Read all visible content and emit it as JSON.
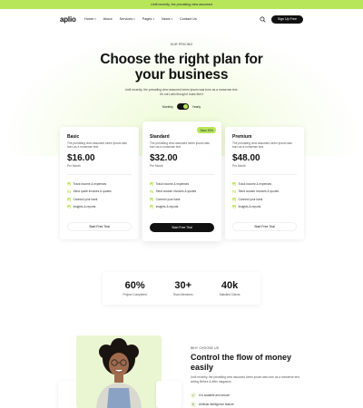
{
  "announcement": {
    "text": "Until recently, the prevailing view assumed"
  },
  "nav": {
    "logo": "aplio",
    "items": [
      {
        "label": "Home",
        "dropdown": true
      },
      {
        "label": "About",
        "dropdown": false
      },
      {
        "label": "Services",
        "dropdown": true
      },
      {
        "label": "Pages",
        "dropdown": true
      },
      {
        "label": "News",
        "dropdown": true
      },
      {
        "label": "Contact Us",
        "dropdown": false
      }
    ],
    "cta": "Sign Up Free"
  },
  "hero": {
    "eyebrow": "OUR PRICING",
    "title_line1": "Choose the right plan for",
    "title_line2": "your business",
    "subtitle": "Until recently, the prevailing view assumed lorem ipsum was born as a nonsense text. It's not Latin though it looks like it",
    "toggle_left": "Monthly",
    "toggle_right": "Yearly"
  },
  "plans": [
    {
      "name": "Basic",
      "description": "The prevailing view assumed lorem ipsum was born as a nonsense text.",
      "price": "$16.00",
      "period": "Per Month",
      "features": [
        "Track income & expenses",
        "Send quote invoices & quotes",
        "Connect your bank",
        "Insights & reports"
      ],
      "button": "Start Free Trial",
      "badge": ""
    },
    {
      "name": "Standard",
      "description": "The prevailing view assumed lorem ipsum was born as a nonsense text.",
      "price": "$32.00",
      "period": "Per Month",
      "features": [
        "Track income & expenses",
        "Send custom invoices & quotes",
        "Connect your bank",
        "Insights & reports"
      ],
      "button": "Start Free Trial",
      "badge": "Save 20%"
    },
    {
      "name": "Premium",
      "description": "The prevailing view assumed lorem ipsum was born as a nonsense text.",
      "price": "$48.00",
      "period": "Per Month",
      "features": [
        "Track income & expenses",
        "Send custom invoices & quotes",
        "Connect your bank",
        "Insights & reports"
      ],
      "button": "Start Free Trial",
      "badge": ""
    }
  ],
  "stats": [
    {
      "value": "60%",
      "label": "Project Completed"
    },
    {
      "value": "30+",
      "label": "Team Members"
    },
    {
      "value": "40k",
      "label": "Satisfied Clients"
    }
  ],
  "why": {
    "eyebrow": "WHY CHOOSE US",
    "title": "Control the flow of money easily",
    "description": "Until recently, the prevailing view assumed lorem ipsum was born as a nonsense text writing Before & After magazine.",
    "features": [
      "It is scalable and secure",
      "Artificial intelligence feature"
    ]
  },
  "colors": {
    "accent": "#b8e65a",
    "dark": "#111111"
  }
}
